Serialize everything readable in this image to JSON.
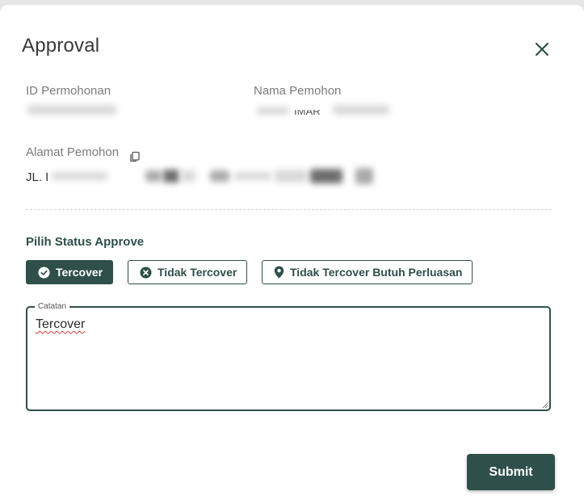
{
  "dialog": {
    "title": "Approval",
    "close_icon": "close-icon"
  },
  "fields": {
    "id_label": "ID Permohonan",
    "name_label": "Nama Pemohon",
    "name_value_partial": "IMAR",
    "address_label": "Alamat Pemohon",
    "address_value_partial": "JL. I",
    "copy_icon": "copy-icon"
  },
  "status": {
    "section_label": "Pilih Status Approve",
    "options": [
      {
        "label": "Tercover",
        "icon": "check-circle-icon",
        "selected": true
      },
      {
        "label": "Tidak Tercover",
        "icon": "x-circle-icon",
        "selected": false
      },
      {
        "label": "Tidak Tercover Butuh Perluasan",
        "icon": "location-pin-icon",
        "selected": false
      }
    ]
  },
  "notes": {
    "legend": "Catatan",
    "value": "Tercover"
  },
  "actions": {
    "submit_label": "Submit"
  },
  "colors": {
    "accent": "#2f4f4a",
    "label_gray": "#7b7b7b"
  }
}
